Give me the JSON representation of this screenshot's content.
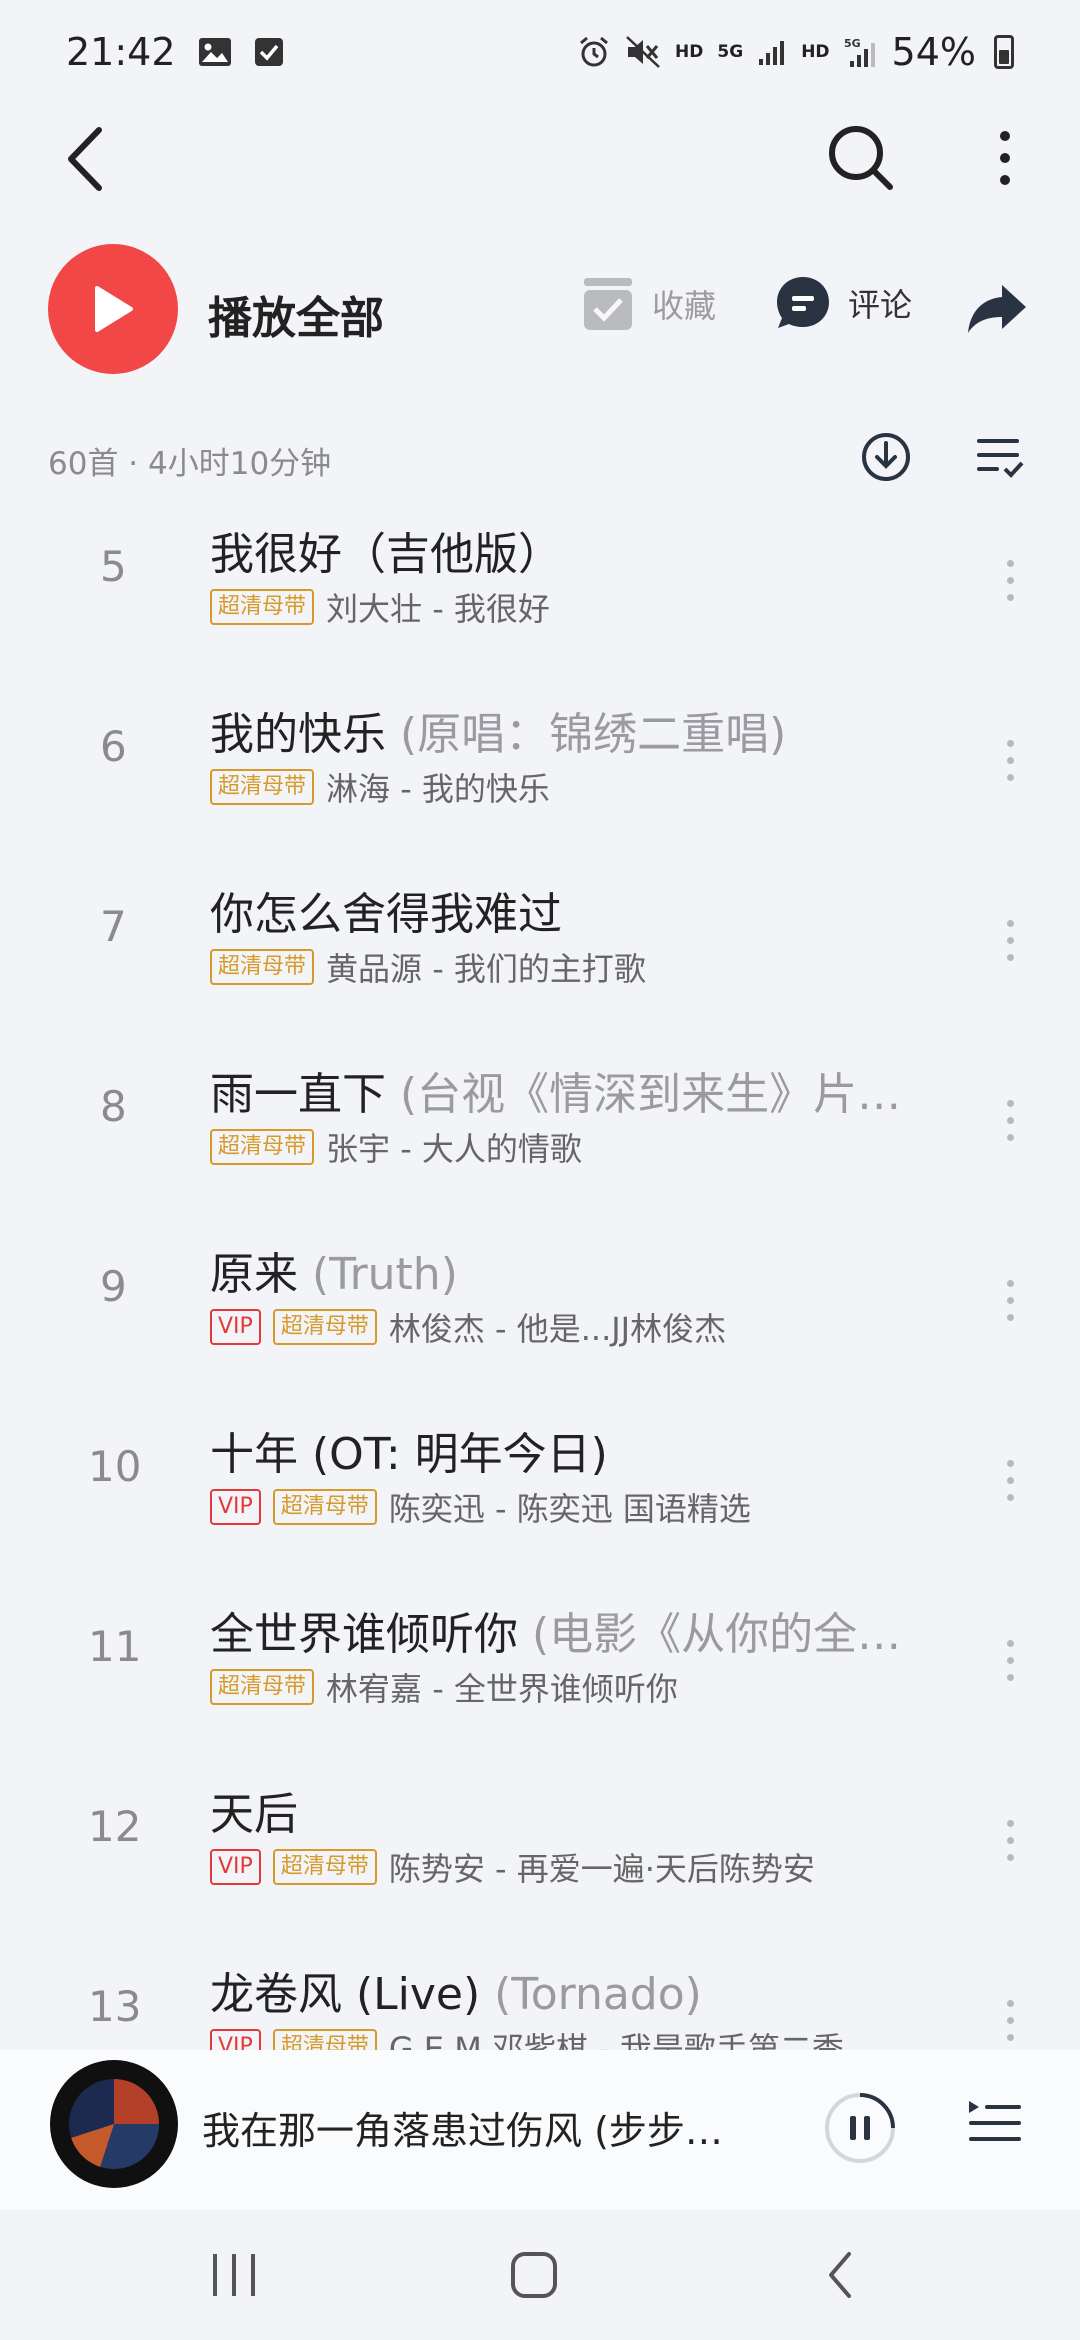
{
  "status_bar": {
    "time": "21:42",
    "battery": "54%",
    "left_icons": [
      "image-icon",
      "checkbox-icon"
    ],
    "right_icons": [
      "alarm-icon",
      "mute-icon",
      "hd-icon",
      "5g-icon",
      "signal-icon",
      "hd-icon",
      "5g-signal-icon",
      "battery-icon"
    ],
    "hd": "HD",
    "fiveg": "5G"
  },
  "header": {
    "back_icon": "back-arrow-icon",
    "search_icon": "search-icon",
    "more_icon": "more-vertical-icon"
  },
  "actions": {
    "play_all_label": "播放全部",
    "collect_label": "收藏",
    "comment_label": "评论",
    "share_icon": "share-icon"
  },
  "list_header": {
    "count_text": "60首 · 4小时10分钟",
    "download_icon": "download-icon",
    "multi_select_icon": "multi-select-icon"
  },
  "songs": [
    {
      "index": "5",
      "title": "我很好（吉他版）",
      "alt": "",
      "vip": false,
      "hq_label": "超清母带",
      "meta": "刘大壮 - 我很好"
    },
    {
      "index": "6",
      "title": "我的快乐 ",
      "alt": "(原唱：锦绣二重唱)",
      "vip": false,
      "hq_label": "超清母带",
      "meta": "淋海 - 我的快乐"
    },
    {
      "index": "7",
      "title": "你怎么舍得我难过",
      "alt": "",
      "vip": false,
      "hq_label": "超清母带",
      "meta": "黄品源 - 我们的主打歌"
    },
    {
      "index": "8",
      "title": "雨一直下 ",
      "alt": "(台视《情深到来生》片…",
      "vip": false,
      "hq_label": "超清母带",
      "meta": "张宇 - 大人的情歌"
    },
    {
      "index": "9",
      "title": "原来 ",
      "alt": "(Truth)",
      "vip": true,
      "vip_label": "VIP",
      "hq_label": "超清母带",
      "meta": "林俊杰 - 他是...JJ林俊杰"
    },
    {
      "index": "10",
      "title": "十年 (OT: 明年今日)",
      "alt": "",
      "vip": true,
      "vip_label": "VIP",
      "hq_label": "超清母带",
      "meta": "陈奕迅 - 陈奕迅 国语精选"
    },
    {
      "index": "11",
      "title": "全世界谁倾听你 ",
      "alt": "(电影《从你的全…",
      "vip": false,
      "hq_label": "超清母带",
      "meta": "林宥嘉 - 全世界谁倾听你"
    },
    {
      "index": "12",
      "title": "天后",
      "alt": "",
      "vip": true,
      "vip_label": "VIP",
      "hq_label": "超清母带",
      "meta": "陈势安 - 再爱一遍·天后陈势安"
    },
    {
      "index": "13",
      "title": "龙卷风 (Live) ",
      "alt": "(Tornado)",
      "vip": true,
      "vip_label": "VIP",
      "hq_label": "超清母带",
      "meta": "G.E.M.邓紫棋 - 我是歌手第二季"
    }
  ],
  "player": {
    "now_playing": "我在那一角落患过伤风 (步步…",
    "pause_icon": "pause-icon",
    "playlist_icon": "playlist-icon"
  },
  "nav": {
    "recents_icon": "recents-icon",
    "home_icon": "home-icon",
    "back_icon": "back-icon"
  },
  "colors": {
    "accent": "#f24747",
    "vip": "#e23a3a",
    "hq": "#d69a2a",
    "background": "#f3f4f8"
  }
}
